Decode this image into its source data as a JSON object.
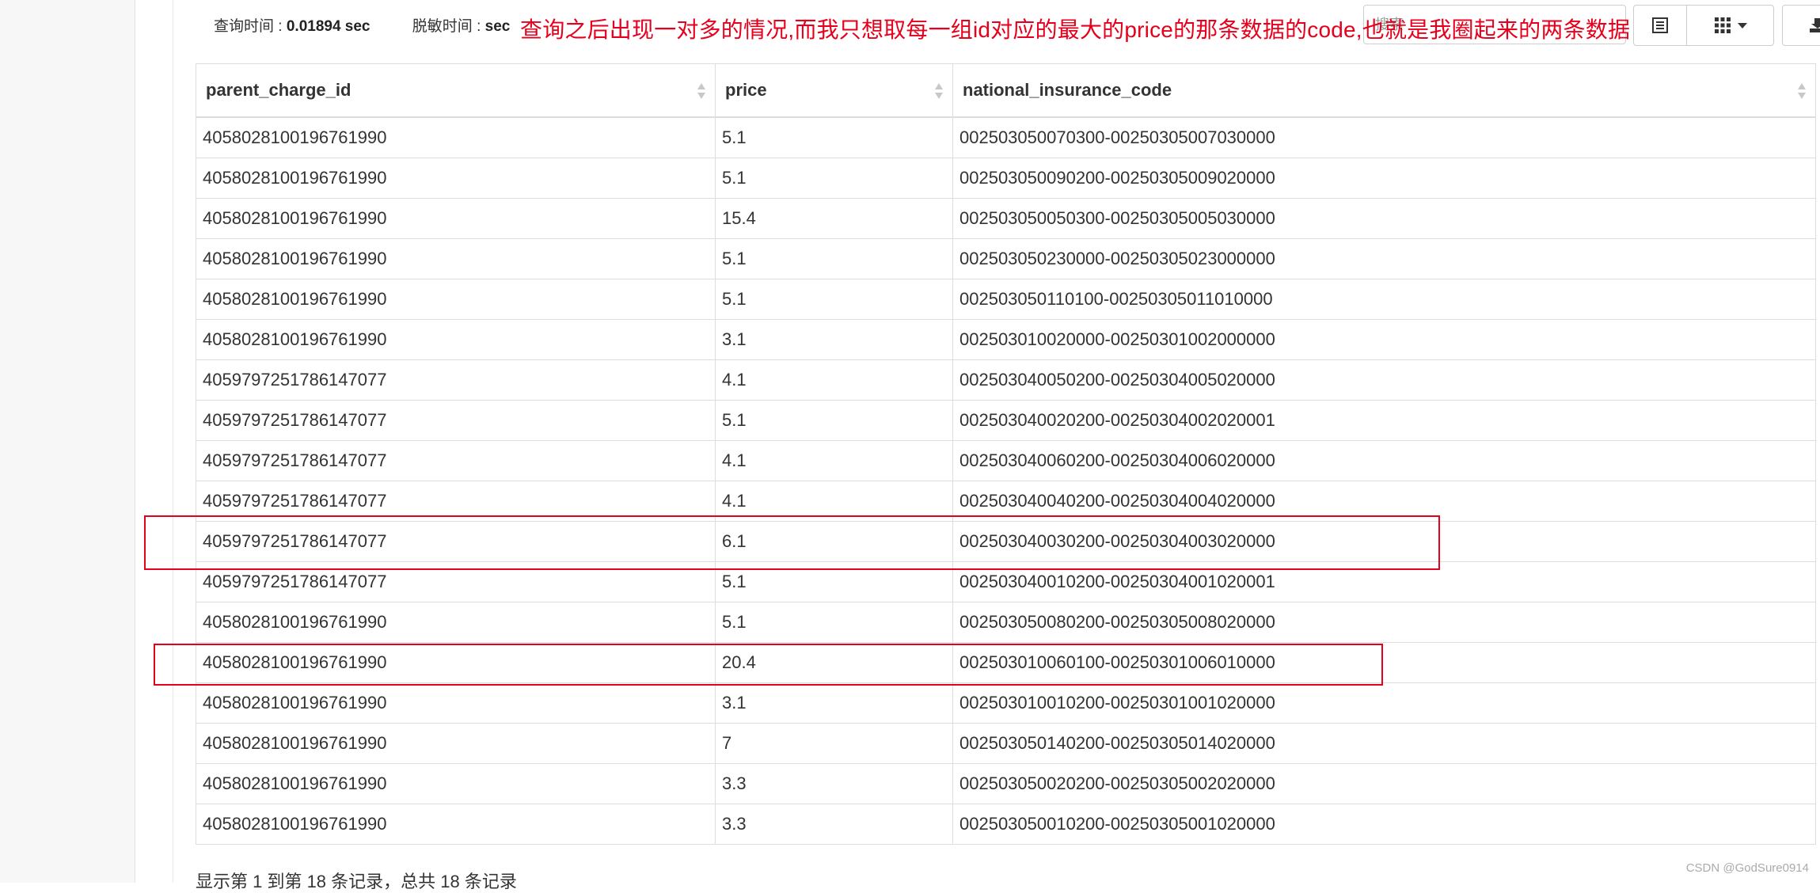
{
  "stats": {
    "query_time_label": "查询时间 : ",
    "query_time_value": "0.01894 sec",
    "desensitize_label": "脱敏时间 : ",
    "desensitize_value": "sec"
  },
  "annotation": {
    "text": "查询之后出现一对多的情况,而我只想取每一组id对应的最大的price的那条数据的code,也就是我圈起来的两条数据",
    "color": "#e6001c"
  },
  "search": {
    "placeholder": "搜索"
  },
  "toolbar": {
    "icons": [
      "list-view-icon",
      "columns-grid-icon",
      "export-icon"
    ]
  },
  "table": {
    "columns": [
      "parent_charge_id",
      "price",
      "national_insurance_code"
    ],
    "rows": [
      [
        "4058028100196761990",
        "5.1",
        "002503050070300-00250305007030000"
      ],
      [
        "4058028100196761990",
        "5.1",
        "002503050090200-00250305009020000"
      ],
      [
        "4058028100196761990",
        "15.4",
        "002503050050300-00250305005030000"
      ],
      [
        "4058028100196761990",
        "5.1",
        "002503050230000-00250305023000000"
      ],
      [
        "4058028100196761990",
        "5.1",
        "002503050110100-00250305011010000"
      ],
      [
        "4058028100196761990",
        "3.1",
        "002503010020000-00250301002000000"
      ],
      [
        "4059797251786147077",
        "4.1",
        "002503040050200-00250304005020000"
      ],
      [
        "4059797251786147077",
        "5.1",
        "002503040020200-00250304002020001"
      ],
      [
        "4059797251786147077",
        "4.1",
        "002503040060200-00250304006020000"
      ],
      [
        "4059797251786147077",
        "4.1",
        "002503040040200-00250304004020000"
      ],
      [
        "4059797251786147077",
        "6.1",
        "002503040030200-00250304003020000"
      ],
      [
        "4059797251786147077",
        "5.1",
        "002503040010200-00250304001020001"
      ],
      [
        "4058028100196761990",
        "5.1",
        "002503050080200-00250305008020000"
      ],
      [
        "4058028100196761990",
        "20.4",
        "002503010060100-00250301006010000"
      ],
      [
        "4058028100196761990",
        "3.1",
        "002503010010200-00250301001020000"
      ],
      [
        "4058028100196761990",
        "7",
        "002503050140200-00250305014020000"
      ],
      [
        "4058028100196761990",
        "3.3",
        "002503050020200-00250305002020000"
      ],
      [
        "4058028100196761990",
        "3.3",
        "002503050010200-00250305001020000"
      ]
    ],
    "highlighted_rows": [
      10,
      13
    ]
  },
  "footer": {
    "text": "显示第 1 到第 18 条记录，总共 18 条记录"
  },
  "watermark": "CSDN @GodSure0914"
}
